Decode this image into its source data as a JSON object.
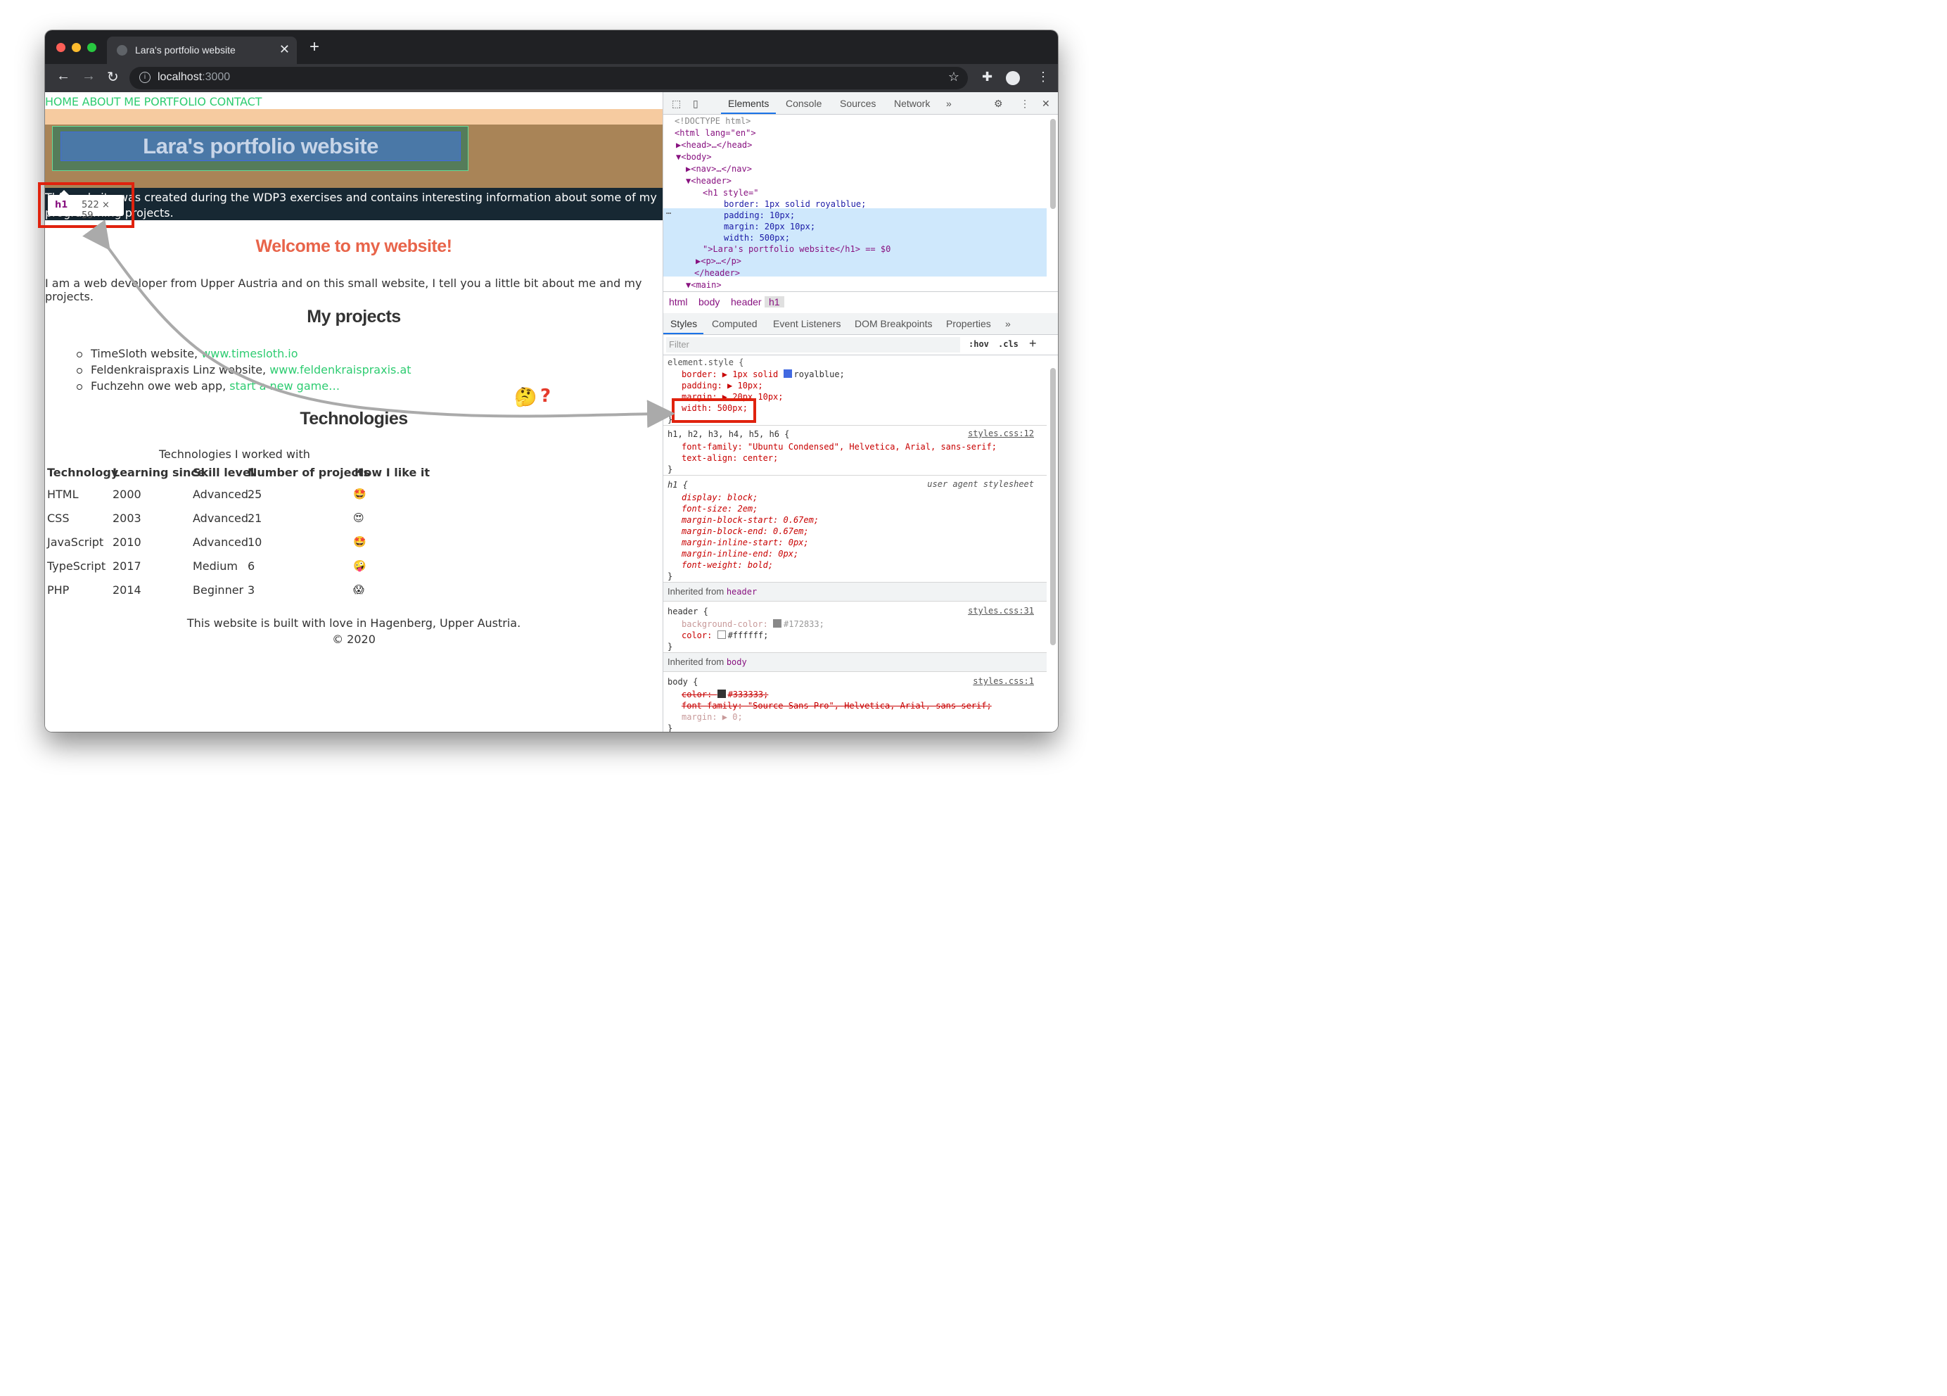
{
  "browser": {
    "tab_title": "Lara's portfolio website",
    "tab_close": "✕",
    "new_tab": "+",
    "url_host": "localhost",
    "url_port": ":3000"
  },
  "page": {
    "nav": "HOME ABOUT ME PORTFOLIO CONTACT",
    "h1": "Lara's portfolio website",
    "intro_line1": "This website was created during the WDP3 exercises and contains interesting information about some of my",
    "intro_line2": "programming projects.",
    "tooltip_tag": "h1",
    "tooltip_dims": "522 × 59",
    "welcome": "Welcome to my website!",
    "paragraph": "I am a web developer from Upper Austria and on this small website, I tell you a little bit about me and my projects.",
    "projects_heading": "My projects",
    "projects": [
      {
        "text": "TimeSloth website, ",
        "link": "www.timesloth.io"
      },
      {
        "text": "Feldenkraispraxis Linz website, ",
        "link": "www.feldenkraispraxis.at"
      },
      {
        "text": "Fuchzehn owe web app, ",
        "link": "start a new game…"
      }
    ],
    "technologies_heading": "Technologies",
    "table_caption": "Technologies I worked with",
    "table_headers": [
      "Technology",
      "Learning since",
      "Skill level",
      "Number of projects",
      "How I like it"
    ],
    "table_rows": [
      [
        "HTML",
        "2000",
        "Advanced",
        "25",
        "🤩"
      ],
      [
        "CSS",
        "2003",
        "Advanced",
        "21",
        "😍"
      ],
      [
        "JavaScript",
        "2010",
        "Advanced",
        "10",
        "🤩"
      ],
      [
        "TypeScript",
        "2017",
        "Medium",
        "6",
        "🤪"
      ],
      [
        "PHP",
        "2014",
        "Beginner",
        "3",
        "😱"
      ]
    ],
    "footer_line1": "This website is built with love in Hagenberg, Upper Austria.",
    "footer_line2": "© 2020",
    "annotation_emoji": "🤔",
    "annotation_mark": "?"
  },
  "devtools": {
    "tabs": [
      "Elements",
      "Console",
      "Sources",
      "Network",
      "»"
    ],
    "dom_lines": [
      "<!DOCTYPE html>",
      "<html lang=\"en\">",
      "▶<head>…</head>",
      "▼<body>",
      "▶<nav>…</nav>",
      "▼<header>",
      "<h1 style=\"",
      "border: 1px solid royalblue;",
      "padding: 10px;",
      "margin: 20px 10px;",
      "width: 500px;",
      "\">Lara's portfolio website</h1> == $0",
      "▶<p>…</p>",
      "</header>",
      "▼<main>"
    ],
    "dom_dots": "…",
    "breadcrumbs": [
      "html",
      "body",
      "header",
      "h1"
    ],
    "style_tabs": [
      "Styles",
      "Computed",
      "Event Listeners",
      "DOM Breakpoints",
      "Properties",
      "»"
    ],
    "filter_placeholder": "Filter",
    "hov": ":hov",
    "cls": ".cls",
    "plus": "+",
    "element_style": {
      "selector": "element.style {",
      "border": "border: ▶ 1px solid",
      "border_color": "royalblue;",
      "padding": "padding: ▶ 10px;",
      "margin": "margin: ▶ 20px 10px;",
      "width": "width: 500px;",
      "close": "}"
    },
    "rule_h": {
      "selector": "h1, h2, h3, h4, h5, h6 {",
      "source": "styles.css:12",
      "l1": "font-family: \"Ubuntu Condensed\", Helvetica, Arial, sans-serif;",
      "l2": "text-align: center;",
      "close": "}"
    },
    "rule_ua": {
      "selector": "h1 {",
      "source": "user agent stylesheet",
      "lines": [
        "display: block;",
        "font-size: 2em;",
        "margin-block-start: 0.67em;",
        "margin-block-end: 0.67em;",
        "margin-inline-start: 0px;",
        "margin-inline-end: 0px;",
        "font-weight: bold;"
      ],
      "close": "}"
    },
    "inherited_header": {
      "label": "Inherited from ",
      "el": "header"
    },
    "rule_header": {
      "selector": "header {",
      "source": "styles.css:31",
      "bg": "background-color: ",
      "bg_val": "#172833;",
      "color": "color: ",
      "color_val": "#ffffff;",
      "close": "}"
    },
    "inherited_body": {
      "label": "Inherited from ",
      "el": "body"
    },
    "rule_body": {
      "selector": "body {",
      "source": "styles.css:1",
      "color": "color: ",
      "color_val": "#333333;",
      "font": "font-family: \"Source Sans Pro\", Helvetica, Arial, sans-serif;",
      "margin": "margin: ▶ 0;",
      "close": "}"
    }
  },
  "colors": {
    "link": "#2ecc71",
    "welcome": "#e8644a",
    "header_bg": "#172833",
    "annotation_red": "#e0220e",
    "arrow_gray": "#aaaaaa"
  }
}
